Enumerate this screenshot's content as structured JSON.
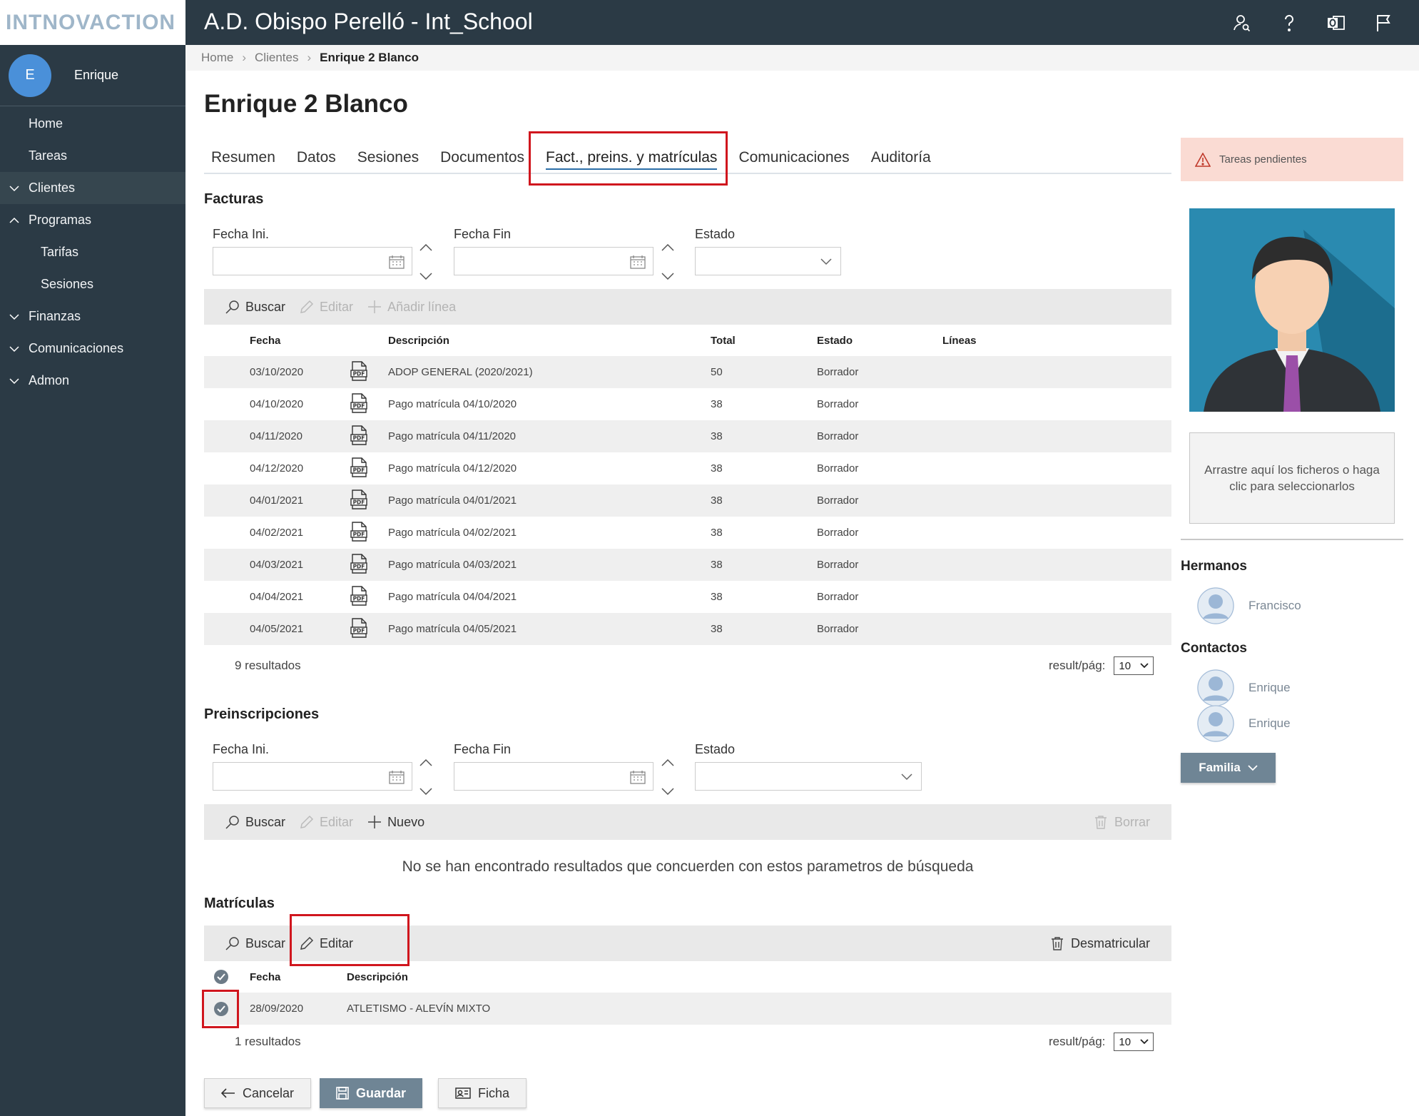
{
  "app": {
    "logo_text": "INTNOVACTION",
    "title": "A.D. Obispo Perelló - Int_School"
  },
  "topbar_icons": [
    "user-search-icon",
    "help-icon",
    "outlook-icon",
    "flag-icon"
  ],
  "user": {
    "initial": "E",
    "name": "Enrique"
  },
  "sidebar": {
    "items": [
      {
        "label": "Home",
        "level": 0,
        "chevron": ""
      },
      {
        "label": "Tareas",
        "level": 0,
        "chevron": ""
      },
      {
        "label": "Clientes",
        "level": 0,
        "chevron": "down"
      },
      {
        "label": "Programas",
        "level": 0,
        "chevron": "up"
      },
      {
        "label": "Tarifas",
        "level": 2,
        "chevron": ""
      },
      {
        "label": "Sesiones",
        "level": 2,
        "chevron": ""
      },
      {
        "label": "Finanzas",
        "level": 0,
        "chevron": "down"
      },
      {
        "label": "Comunicaciones",
        "level": 0,
        "chevron": "down"
      },
      {
        "label": "Admon",
        "level": 0,
        "chevron": "down"
      }
    ]
  },
  "breadcrumb": {
    "home": "Home",
    "clients": "Clientes",
    "current": "Enrique 2 Blanco"
  },
  "page_title": "Enrique 2 Blanco",
  "tabs": [
    "Resumen",
    "Datos",
    "Sesiones",
    "Documentos",
    "Fact., preins. y matrículas",
    "Comunicaciones",
    "Auditoría"
  ],
  "active_tab": "Fact., preins. y matrículas",
  "facturas": {
    "title": "Facturas",
    "filters": {
      "fecha_ini": "Fecha Ini.",
      "fecha_fin": "Fecha Fin",
      "estado": "Estado"
    },
    "toolbar": {
      "buscar": "Buscar",
      "editar": "Editar",
      "anadir": "Añadir línea"
    },
    "columns": {
      "fecha": "Fecha",
      "descripcion": "Descripción",
      "total": "Total",
      "estado": "Estado",
      "lineas": "Líneas"
    },
    "rows": [
      {
        "fecha": "03/10/2020",
        "descripcion": "ADOP GENERAL (2020/2021)",
        "total": "50",
        "estado": "Borrador"
      },
      {
        "fecha": "04/10/2020",
        "descripcion": "Pago matrícula 04/10/2020",
        "total": "38",
        "estado": "Borrador"
      },
      {
        "fecha": "04/11/2020",
        "descripcion": "Pago matrícula 04/11/2020",
        "total": "38",
        "estado": "Borrador"
      },
      {
        "fecha": "04/12/2020",
        "descripcion": "Pago matrícula 04/12/2020",
        "total": "38",
        "estado": "Borrador"
      },
      {
        "fecha": "04/01/2021",
        "descripcion": "Pago matrícula 04/01/2021",
        "total": "38",
        "estado": "Borrador"
      },
      {
        "fecha": "04/02/2021",
        "descripcion": "Pago matrícula 04/02/2021",
        "total": "38",
        "estado": "Borrador"
      },
      {
        "fecha": "04/03/2021",
        "descripcion": "Pago matrícula 04/03/2021",
        "total": "38",
        "estado": "Borrador"
      },
      {
        "fecha": "04/04/2021",
        "descripcion": "Pago matrícula 04/04/2021",
        "total": "38",
        "estado": "Borrador"
      },
      {
        "fecha": "04/05/2021",
        "descripcion": "Pago matrícula 04/05/2021",
        "total": "38",
        "estado": "Borrador"
      }
    ],
    "results": "9 resultados",
    "per_page_label": "result/pág:",
    "per_page_value": "10"
  },
  "preinscripciones": {
    "title": "Preinscripciones",
    "filters": {
      "fecha_ini": "Fecha Ini.",
      "fecha_fin": "Fecha Fin",
      "estado": "Estado"
    },
    "toolbar": {
      "buscar": "Buscar",
      "editar": "Editar",
      "nuevo": "Nuevo",
      "borrar": "Borrar"
    },
    "empty_message": "No se han encontrado resultados que concuerden con estos parametros de búsqueda"
  },
  "matriculas": {
    "title": "Matrículas",
    "toolbar": {
      "buscar": "Buscar",
      "editar": "Editar",
      "desmatricular": "Desmatricular"
    },
    "columns": {
      "fecha": "Fecha",
      "descripcion": "Descripción"
    },
    "rows": [
      {
        "fecha": "28/09/2020",
        "descripcion": "ATLETISMO - ALEVÍN MIXTO",
        "selected": true
      }
    ],
    "results": "1 resultados",
    "per_page_label": "result/pág:",
    "per_page_value": "10"
  },
  "actions": {
    "cancelar": "Cancelar",
    "guardar": "Guardar",
    "ficha": "Ficha"
  },
  "right_panel": {
    "alert": "Tareas pendientes",
    "dropzone": "Arrastre aquí los ficheros o haga clic para seleccionarlos",
    "hermanos_title": "Hermanos",
    "hermanos": [
      "Francisco"
    ],
    "contactos_title": "Contactos",
    "contactos": [
      "Enrique",
      "Enrique"
    ],
    "familia_button": "Familia"
  },
  "colors": {
    "sidebar": "#2b3a45",
    "highlight": "#d0161e",
    "primary_button": "#6f8595",
    "alert_bg": "#fadbd3"
  }
}
